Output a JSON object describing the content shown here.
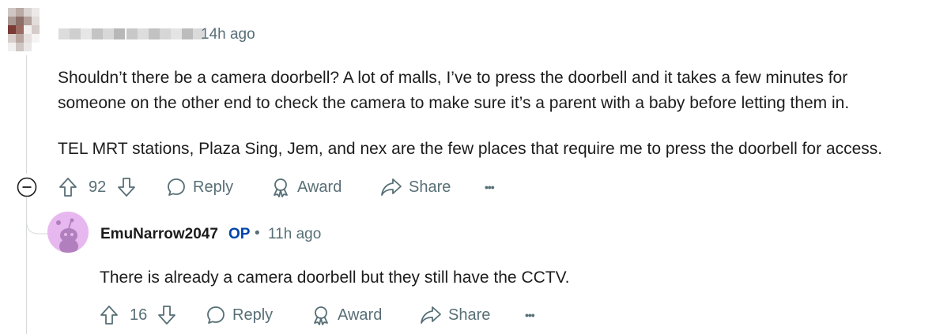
{
  "parent_comment": {
    "timestamp": "14h ago",
    "paragraphs": [
      "Shouldn’t there be a camera doorbell? A lot of malls, I’ve to press the doorbell and it takes a few minutes for",
      "someone on the other end to check the camera to make sure it’s a parent with a baby before letting them in.",
      "TEL MRT stations, Plaza Sing, Jem, and nex are the few places that require me to press the doorbell for access."
    ],
    "actions": {
      "vote_count": "92",
      "reply_label": "Reply",
      "award_label": "Award",
      "share_label": "Share",
      "more_label": "•••"
    }
  },
  "reply_comment": {
    "username": "EmuNarrow2047",
    "op_badge": "OP",
    "separator": "•",
    "timestamp": "11h ago",
    "text": "There is already a camera doorbell but they still have the CCTV.",
    "actions": {
      "vote_count": "16",
      "reply_label": "Reply",
      "award_label": "Award",
      "share_label": "Share",
      "more_label": "•••"
    }
  },
  "colors": {
    "meta": "#576f76",
    "text": "#1c1c1c",
    "op": "#0045ac",
    "thread_line": "#d7dadc",
    "reply_avatar_bg": "#e7b8ef"
  }
}
